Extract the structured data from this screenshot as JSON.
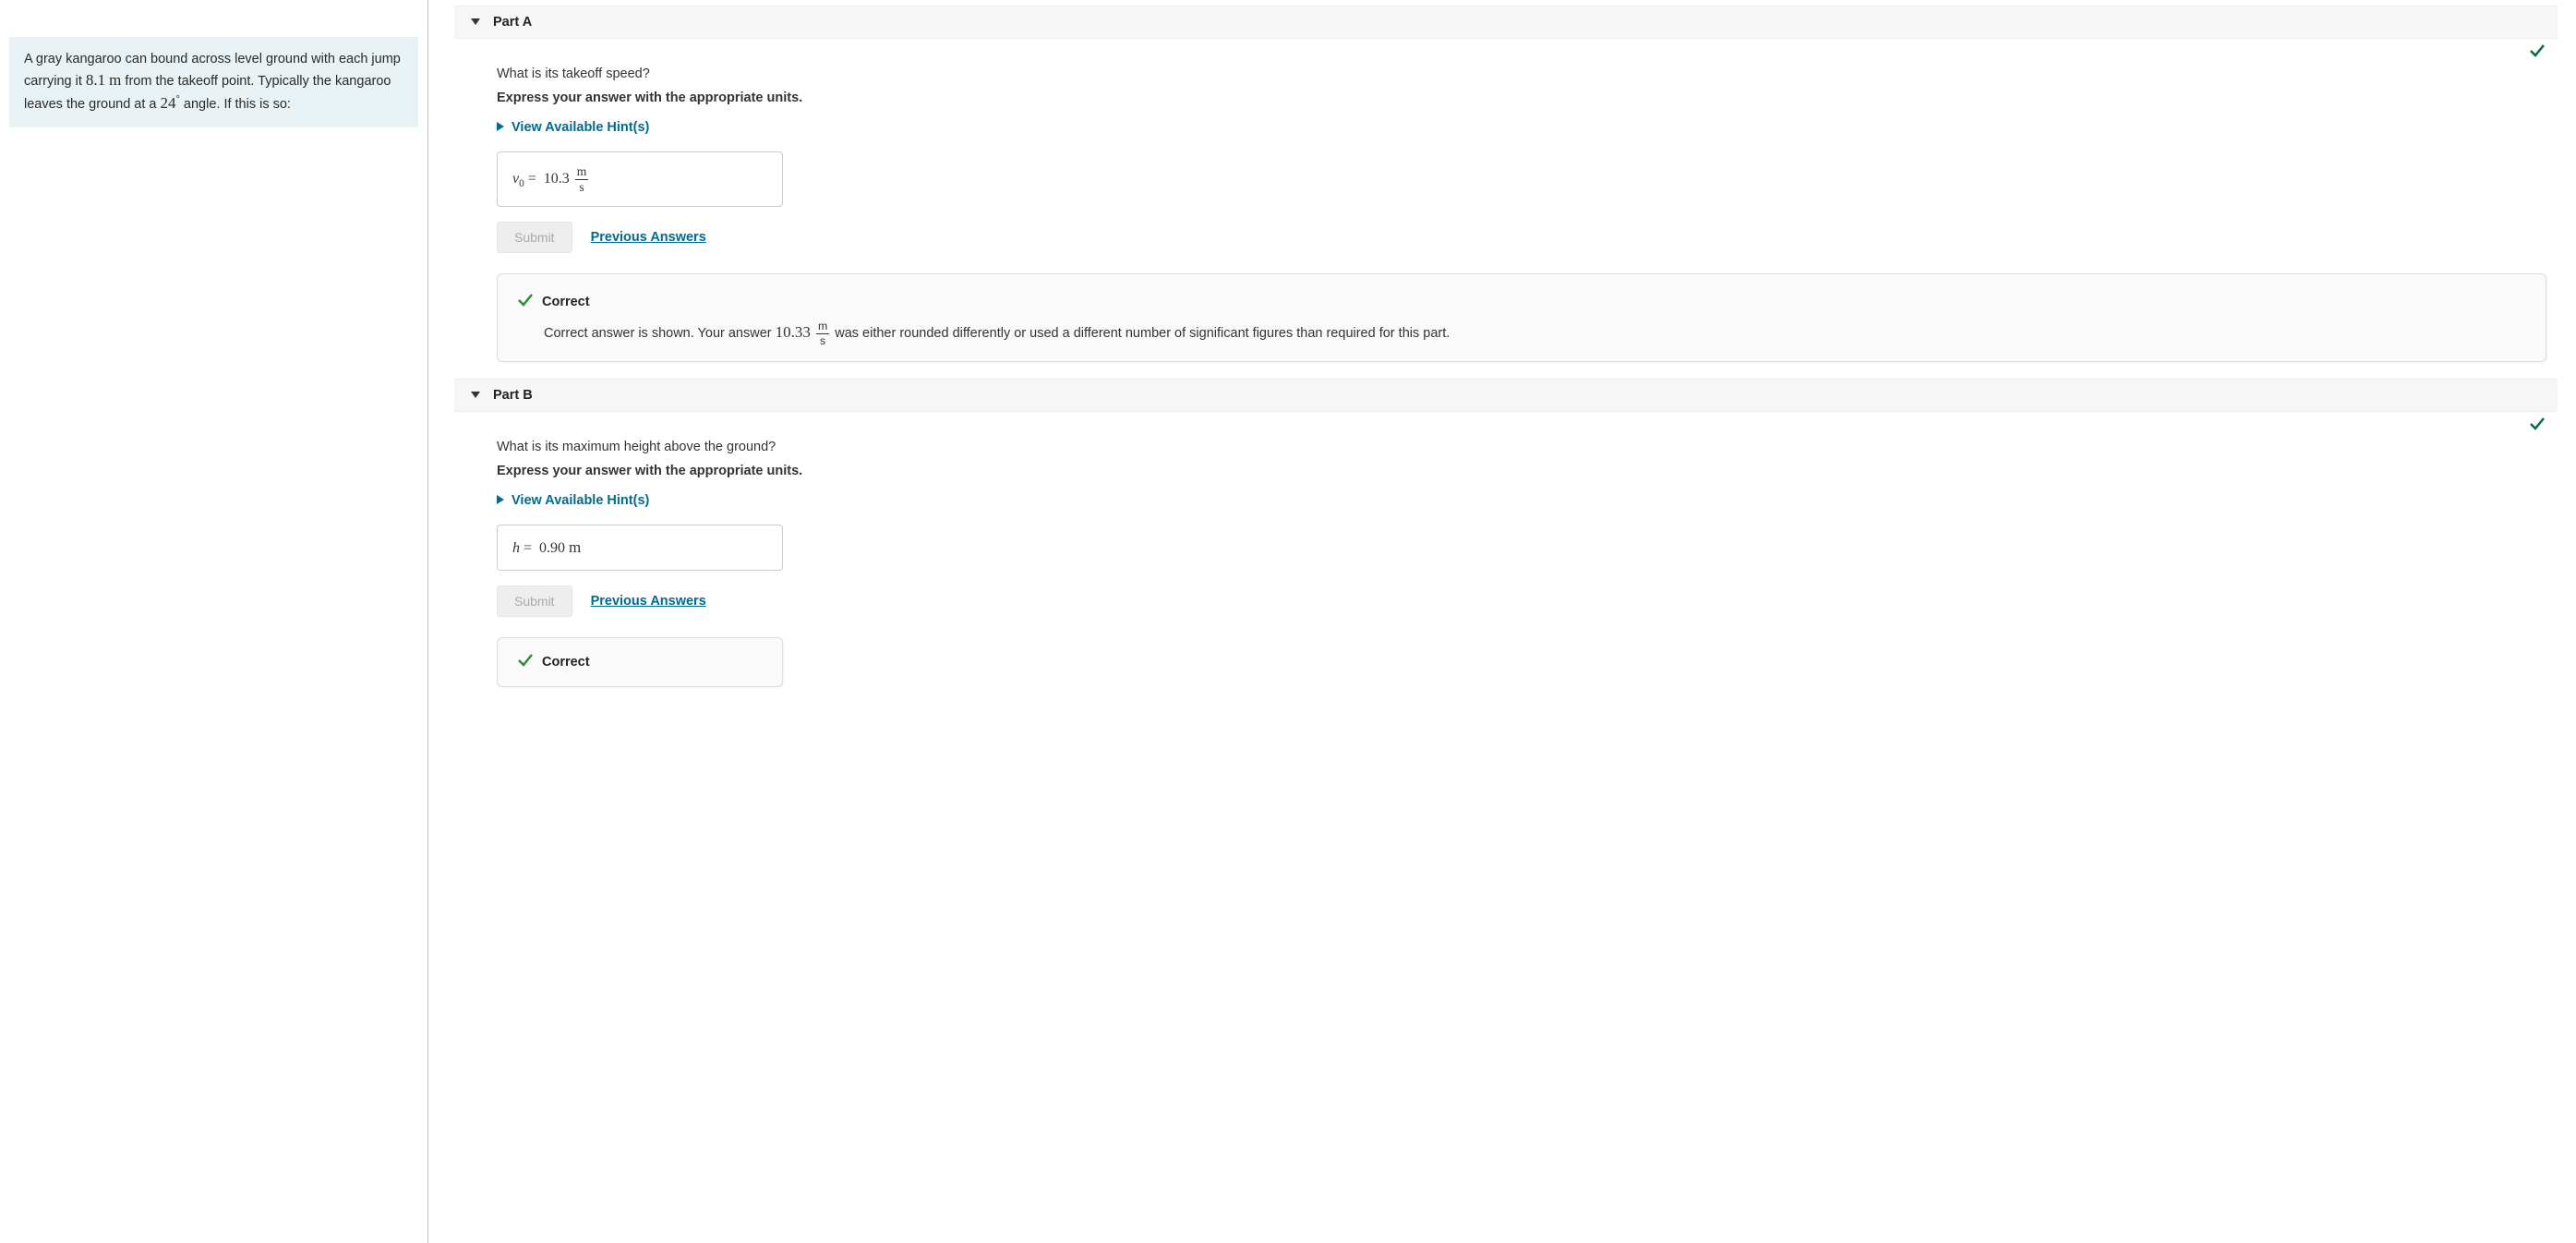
{
  "problem": {
    "text_before_distance": "A gray kangaroo can bound across level ground with each jump carrying it ",
    "distance": "8.1",
    "distance_unit": "m",
    "text_mid": " from the takeoff point. Typically the kangaroo leaves the ground at a ",
    "angle": "24",
    "angle_unit": "°",
    "text_after": " angle. If this is so:"
  },
  "partA": {
    "title": "Part A",
    "question": "What is its takeoff speed?",
    "instruction": "Express your answer with the appropriate units.",
    "hints_label": "View Available Hint(s)",
    "answer_var": "v",
    "answer_sub": "0",
    "answer_eq": " = ",
    "answer_value": "10.3",
    "answer_unit_num": "m",
    "answer_unit_den": "s",
    "submit_label": "Submit",
    "prev_label": "Previous Answers",
    "correct_label": "Correct",
    "feedback_before": "Correct answer is shown. Your answer ",
    "feedback_value": "10.33",
    "feedback_unit_num": "m",
    "feedback_unit_den": "s",
    "feedback_after": " was either rounded differently or used a different number of significant figures than required for this part."
  },
  "partB": {
    "title": "Part B",
    "question": "What is its maximum height above the ground?",
    "instruction": "Express your answer with the appropriate units.",
    "hints_label": "View Available Hint(s)",
    "answer_var": "h",
    "answer_eq": " = ",
    "answer_value": "0.90",
    "answer_unit": "m",
    "submit_label": "Submit",
    "prev_label": "Previous Answers",
    "correct_label": "Correct"
  }
}
